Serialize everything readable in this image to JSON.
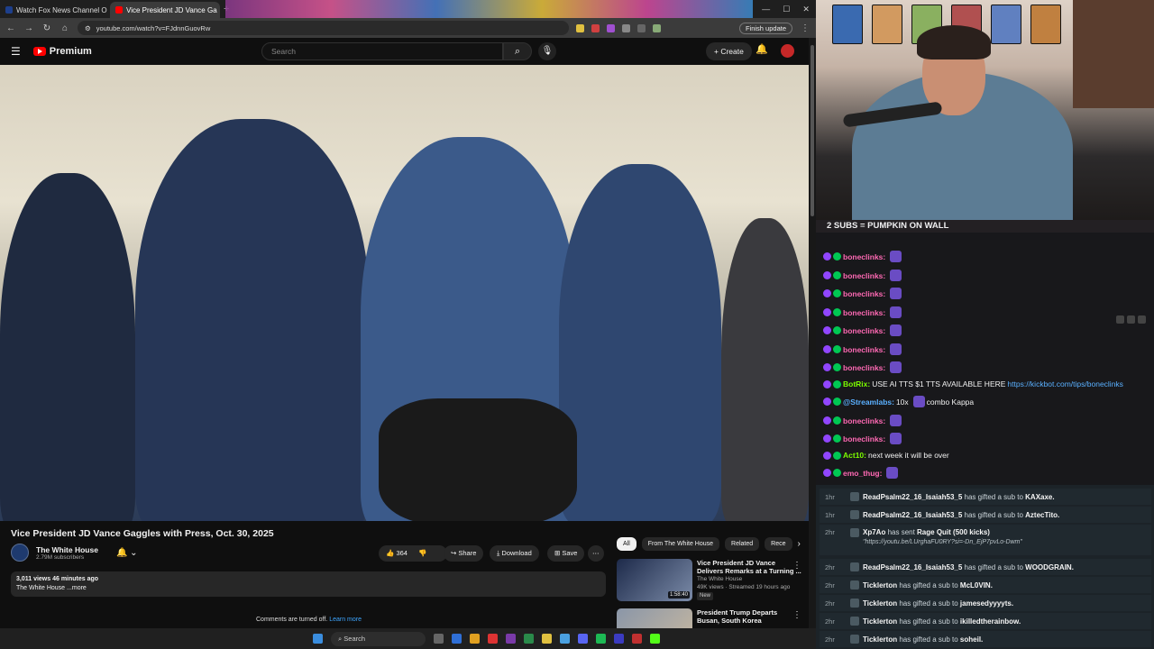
{
  "browser": {
    "tabs": [
      {
        "label": "Watch Fox News Channel O"
      },
      {
        "label": "Vice President JD Vance Ga"
      }
    ],
    "url": "youtube.com/watch?v=FJdnnGuovRw",
    "finish_update": "Finish update"
  },
  "youtube": {
    "logo": "Premium",
    "search_placeholder": "Search",
    "create": "Create",
    "video_title": "Vice President JD Vance Gaggles with Press, Oct. 30, 2025",
    "channel": "The White House",
    "subscribers": "2.79M subscribers",
    "likes": "364",
    "share": "Share",
    "download": "Download",
    "save": "Save",
    "views_line": "3,011 views  46 minutes ago",
    "desc_line": "The White House ...more",
    "comments_off": "Comments are turned off.",
    "learn_more": "Learn more",
    "chips": [
      "All",
      "From The White House",
      "Related",
      "Rece"
    ],
    "related": [
      {
        "title1": "Vice President JD Vance",
        "title2": "Delivers Remarks at a Turning ...",
        "channel": "The White House",
        "meta": "49K views · Streamed 19 hours ago",
        "badge": "New",
        "duration": "1:58:40"
      },
      {
        "title1": "President Trump Departs",
        "title2": "Busan, South Korea",
        "channel": "",
        "meta": "",
        "badge": "",
        "duration": ""
      }
    ]
  },
  "taskbar": {
    "search": "Search"
  },
  "stream": {
    "subgoal": "2 SUBS = PUMPKIN ON WALL",
    "chat": [
      {
        "user": "boneclinks:",
        "color": "#ff69b4",
        "text": ""
      },
      {
        "user": "boneclinks:",
        "color": "#ff69b4",
        "text": ""
      },
      {
        "user": "boneclinks:",
        "color": "#ff69b4",
        "text": ""
      },
      {
        "user": "boneclinks:",
        "color": "#ff69b4",
        "text": ""
      },
      {
        "user": "boneclinks:",
        "color": "#ff69b4",
        "text": ""
      },
      {
        "user": "boneclinks:",
        "color": "#ff69b4",
        "text": ""
      },
      {
        "user": "boneclinks:",
        "color": "#ff69b4",
        "text": ""
      },
      {
        "user": "BotRix:",
        "color": "#7cfc00",
        "text": "USE AI TTS $1 TTS AVAILABLE HERE",
        "link": "https://kickbot.com/tips/boneclinks"
      },
      {
        "user": "@Streamlabs:",
        "color": "#5ab0ff",
        "text": "10x",
        "tail": "combo Kappa"
      },
      {
        "user": "boneclinks:",
        "color": "#ff69b4",
        "text": ""
      },
      {
        "user": "boneclinks:",
        "color": "#ff69b4",
        "text": ""
      },
      {
        "user": "Act10:",
        "color": "#7cfc00",
        "text": "next week it will be over"
      },
      {
        "user": "emo_thug:",
        "color": "#ff69b4",
        "text": ""
      }
    ],
    "events": [
      {
        "time": "1hr",
        "user": "ReadPsalm22_16_Isaiah53_5",
        "text": "has gifted a sub to",
        "target": "KAXaxe."
      },
      {
        "time": "1hr",
        "user": "ReadPsalm22_16_Isaiah53_5",
        "text": "has gifted a sub to",
        "target": "AztecTito."
      },
      {
        "time": "2hr",
        "user": "Xp7Ao",
        "text": "has sent",
        "target": "Rage Quit (500 kicks)",
        "extra": "\"https://youtu.be/LUrghaFU0RY?si=-Dn_EjP7pvLo-Dwm\""
      },
      {
        "time": "2hr",
        "user": "ReadPsalm22_16_Isaiah53_5",
        "text": "has gifted a sub to",
        "target": "WOODGRAIN."
      },
      {
        "time": "2hr",
        "user": "Ticklerton",
        "text": "has gifted a sub to",
        "target": "McL0VIN."
      },
      {
        "time": "2hr",
        "user": "Ticklerton",
        "text": "has gifted a sub to",
        "target": "jamesedyyyyts."
      },
      {
        "time": "2hr",
        "user": "Ticklerton",
        "text": "has gifted a sub to",
        "target": "ikilledtherainbow."
      },
      {
        "time": "2hr",
        "user": "Ticklerton",
        "text": "has gifted a sub to",
        "target": "soheil."
      }
    ]
  },
  "colors": {
    "youtube_red": "#ff0000",
    "chat_bg": "#18181b",
    "events_bg": "#1c2328"
  }
}
